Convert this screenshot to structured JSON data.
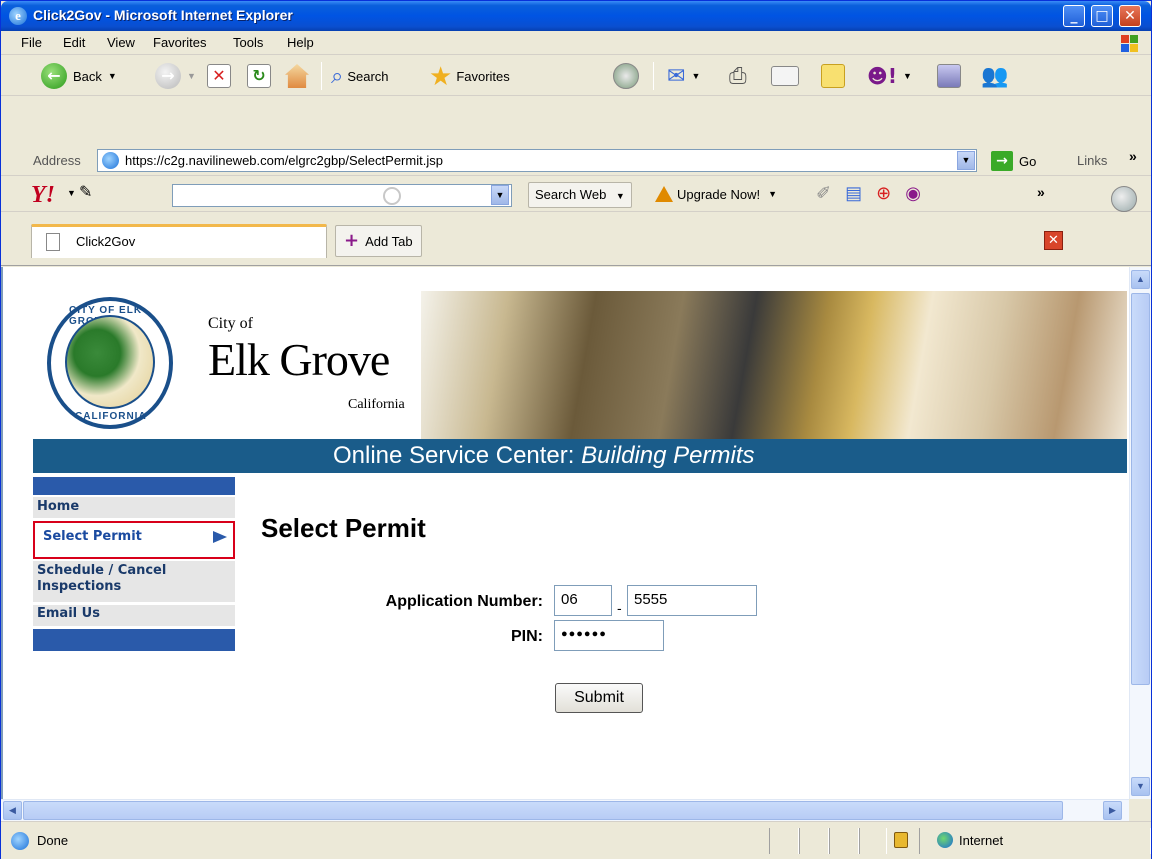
{
  "window": {
    "title": "Click2Gov - Microsoft Internet Explorer"
  },
  "menu": [
    "File",
    "Edit",
    "View",
    "Favorites",
    "Tools",
    "Help"
  ],
  "toolbar": {
    "back": "Back",
    "search": "Search",
    "favorites": "Favorites"
  },
  "address": {
    "label": "Address",
    "url": "https://c2g.navilineweb.com/elgrc2gbp/SelectPermit.jsp",
    "go": "Go",
    "links": "Links"
  },
  "yahoo": {
    "search_web": "Search Web",
    "upgrade": "Upgrade Now!",
    "search_value": ""
  },
  "tabs": {
    "active": "Click2Gov",
    "add": "Add Tab"
  },
  "banner": {
    "city_of": "City of",
    "city_name": "Elk Grove",
    "state": "California",
    "seal_top": "CITY OF ELK GROVE",
    "seal_bottom": "CALIFORNIA",
    "subtitle_main": "Online Service Center: ",
    "subtitle_em": "Building Permits"
  },
  "nav": {
    "items": [
      "Home",
      "Select Permit",
      "Schedule / Cancel Inspections",
      "Email Us"
    ],
    "active_index": 1
  },
  "form": {
    "title": "Select Permit",
    "app_number_label": "Application Number:",
    "app_number_part1": "06",
    "app_number_part2": "5555",
    "dash": "-",
    "pin_label": "PIN:",
    "pin_value": "●●●●●●",
    "submit": "Submit"
  },
  "status": {
    "text": "Done",
    "zone": "Internet"
  }
}
